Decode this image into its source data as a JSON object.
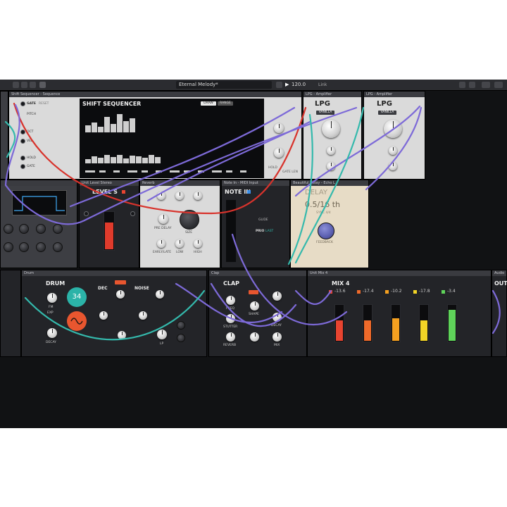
{
  "toolbar": {
    "project_title": "Eternal Melody*",
    "tempo": "120.0",
    "link_label": "Link"
  },
  "modules": {
    "shift_sequencer": {
      "header": "Shift Sequencer - Sequence",
      "title": "SHIFT SEQUENCER",
      "gate": "GATE",
      "reset": "RESET",
      "pitch": "PITCH",
      "oct": "OCT",
      "vel": "VEL",
      "hold": "HOLD",
      "gate_out": "GATE",
      "draw": "DRAW",
      "range": "RANGE",
      "hold_right": "HOLD",
      "gate_len": "GATE LEN"
    },
    "lpg_a": {
      "header": "LPG - Amplifier",
      "title": "LPG",
      "badge": "VANILLA"
    },
    "lpg_b": {
      "header": "LPG - Amplifier",
      "title": "LPG",
      "badge": "VANILLA"
    },
    "level": {
      "header": "Unit Level Stereo",
      "title": "LEVEL S"
    },
    "reverb": {
      "header": "Reverb",
      "pre_delay": "PRE DELAY",
      "size": "SIZE",
      "early_late": "EARLY/LATE",
      "low": "LOW",
      "high": "HIGH"
    },
    "note_in": {
      "header": "Note In - MIDI Input",
      "title": "NOTE IN",
      "glide": "GLIDE",
      "prio": "PRIO",
      "last": "LAST"
    },
    "delay": {
      "header": "Beautiful Delay - Echo L",
      "title": "DELAY",
      "value": "0.5/16 th",
      "sub": "SYNC 4/4",
      "feedback": "FEEDBACK"
    },
    "drum": {
      "header": "Drum",
      "title": "DRUM",
      "dec": "DEC",
      "noise": "NOISE",
      "pitch_display": "34",
      "fm": "FM",
      "exp": "EXP",
      "decay": "DECAY",
      "lp": "LP"
    },
    "clap": {
      "header": "Clap",
      "title": "CLAP",
      "freq": "FREQ",
      "shape": "SHAPE",
      "stutter": "STUTTER",
      "decay": "DECAY",
      "reverb": "REVERB",
      "mix": "MIX"
    },
    "mix": {
      "header": "Unit Mix 4",
      "title": "MIX 4",
      "channels": [
        {
          "db": "-13.6",
          "color": "#e84430",
          "level": 0.55
        },
        {
          "db": "-17.4",
          "color": "#ef6a2a",
          "level": 0.55
        },
        {
          "db": "-10.2",
          "color": "#f4a020",
          "level": 0.62
        },
        {
          "db": "-17.8",
          "color": "#f2d426",
          "level": 0.55
        },
        {
          "db": "-3.4",
          "color": "#5fd35a",
          "level": 0.85
        }
      ]
    },
    "audio_out": {
      "header": "Audio",
      "title": "OUT"
    }
  },
  "colors": {
    "cable_purple": "#7d6ad8",
    "cable_teal": "#34b9ac",
    "cable_red": "#d8332c"
  }
}
